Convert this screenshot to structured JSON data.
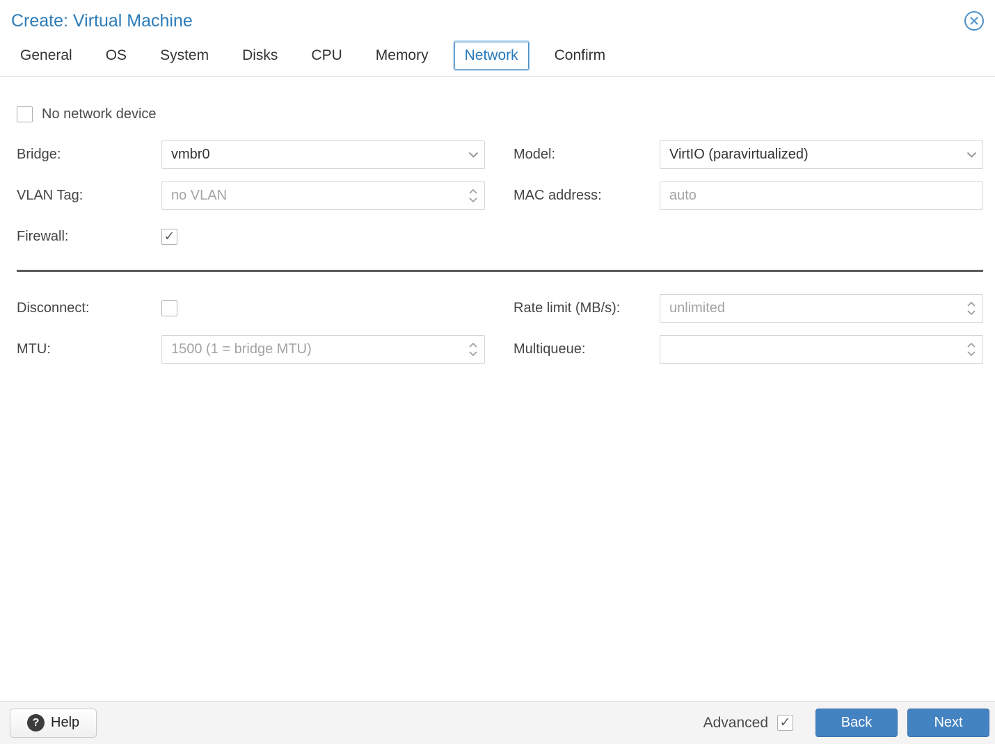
{
  "dialog": {
    "title": "Create: Virtual Machine"
  },
  "tabs": [
    {
      "label": "General"
    },
    {
      "label": "OS"
    },
    {
      "label": "System"
    },
    {
      "label": "Disks"
    },
    {
      "label": "CPU"
    },
    {
      "label": "Memory"
    },
    {
      "label": "Network"
    },
    {
      "label": "Confirm"
    }
  ],
  "active_tab": "Network",
  "form": {
    "no_network_device": {
      "label": "No network device",
      "checked": false,
      "check_glyph": ""
    },
    "bridge": {
      "label": "Bridge:",
      "value": "vmbr0"
    },
    "model": {
      "label": "Model:",
      "value": "VirtIO (paravirtualized)"
    },
    "vlan_tag": {
      "label": "VLAN Tag:",
      "placeholder": "no VLAN"
    },
    "mac_address": {
      "label": "MAC address:",
      "placeholder": "auto"
    },
    "firewall": {
      "label": "Firewall:",
      "checked": true,
      "check_glyph": "✓"
    },
    "disconnect": {
      "label": "Disconnect:",
      "checked": false,
      "check_glyph": ""
    },
    "rate_limit": {
      "label": "Rate limit (MB/s):",
      "placeholder": "unlimited"
    },
    "mtu": {
      "label": "MTU:",
      "placeholder": "1500 (1 = bridge MTU)"
    },
    "multiqueue": {
      "label": "Multiqueue:",
      "placeholder": ""
    }
  },
  "footer": {
    "help_label": "Help",
    "help_icon": "?",
    "advanced_label": "Advanced",
    "advanced_checked": true,
    "advanced_check_glyph": "✓",
    "back_label": "Back",
    "next_label": "Next"
  },
  "colors": {
    "title_blue": "#2b7cb9",
    "tab_active_blue": "#2779bd",
    "button_blue": "#4483c2",
    "divider_gray": "#5a5a5a"
  }
}
